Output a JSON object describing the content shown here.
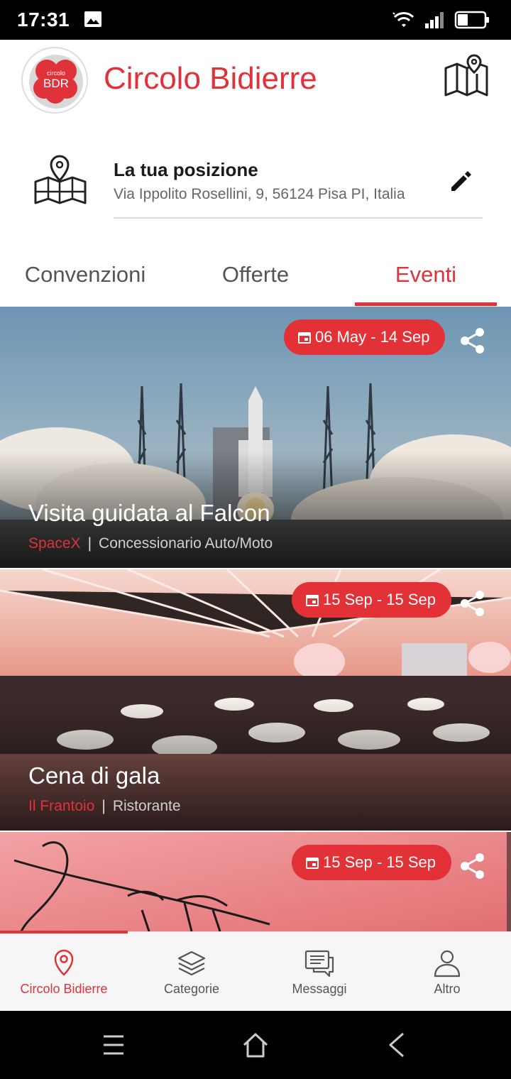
{
  "status_bar": {
    "time": "17:31"
  },
  "header": {
    "title": "Circolo Bidierre",
    "logo_text_top": "circolo",
    "logo_text": "BDR"
  },
  "location": {
    "title": "La tua posizione",
    "address": "Via Ippolito Rosellini, 9, 56124 Pisa PI, Italia"
  },
  "tabs": [
    {
      "label": "Convenzioni",
      "active": false
    },
    {
      "label": "Offerte",
      "active": false
    },
    {
      "label": "Eventi",
      "active": true
    }
  ],
  "events": [
    {
      "date_range": "06 May - 14 Sep",
      "title": "Visita guidata al Falcon",
      "brand": "SpaceX",
      "category": "Concessionario Auto/Moto"
    },
    {
      "date_range": "15 Sep - 15 Sep",
      "title": "Cena di gala",
      "brand": "Il Frantoio",
      "category": "Ristorante"
    },
    {
      "date_range": "15 Sep - 15 Sep",
      "title": "",
      "brand": "",
      "category": ""
    }
  ],
  "bottom_nav": [
    {
      "label": "Circolo Bidierre",
      "icon": "location-pin-icon",
      "active": true
    },
    {
      "label": "Categorie",
      "icon": "layers-icon",
      "active": false
    },
    {
      "label": "Messaggi",
      "icon": "chat-icon",
      "active": false
    },
    {
      "label": "Altro",
      "icon": "person-icon",
      "active": false
    }
  ],
  "colors": {
    "accent": "#e0323a",
    "badge": "#e23238"
  }
}
